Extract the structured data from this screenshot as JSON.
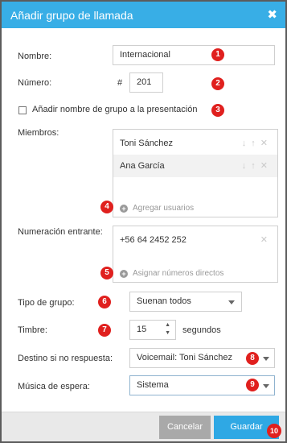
{
  "dialog": {
    "title": "Añadir grupo de llamada",
    "close_icon": "close-icon"
  },
  "form": {
    "nombre": {
      "label": "Nombre:",
      "value": "Internacional"
    },
    "numero": {
      "label": "Número:",
      "prefix": "#",
      "value": "201"
    },
    "checkbox": {
      "label": "Añadir nombre de grupo a la presentación",
      "checked": false
    },
    "miembros": {
      "label": "Miembros:",
      "items": [
        {
          "name": "Toni Sánchez"
        },
        {
          "name": "Ana García"
        }
      ],
      "add_label": "Agregar usuarios"
    },
    "numeracion": {
      "label": "Numeración entrante:",
      "items": [
        {
          "number": "+56 64 2452 252"
        }
      ],
      "add_label": "Asignar números directos"
    },
    "tipo_grupo": {
      "label": "Tipo de grupo:",
      "value": "Suenan todos"
    },
    "timbre": {
      "label": "Timbre:",
      "value": "15",
      "unit": "segundos"
    },
    "destino": {
      "label": "Destino si no respuesta:",
      "value": "Voicemail: Toni Sánchez"
    },
    "musica": {
      "label": "Música de espera:",
      "value": "Sistema"
    }
  },
  "badges": [
    "1",
    "2",
    "3",
    "4",
    "5",
    "6",
    "7",
    "8",
    "9",
    "10"
  ],
  "footer": {
    "cancel_label": "Cancelar",
    "save_label": "Guardar"
  },
  "colors": {
    "accent": "#38aee6",
    "badge": "#e0201e",
    "cancel": "#a9a9a9",
    "save": "#2fa8e4",
    "overlay": "#5c5c5c"
  }
}
